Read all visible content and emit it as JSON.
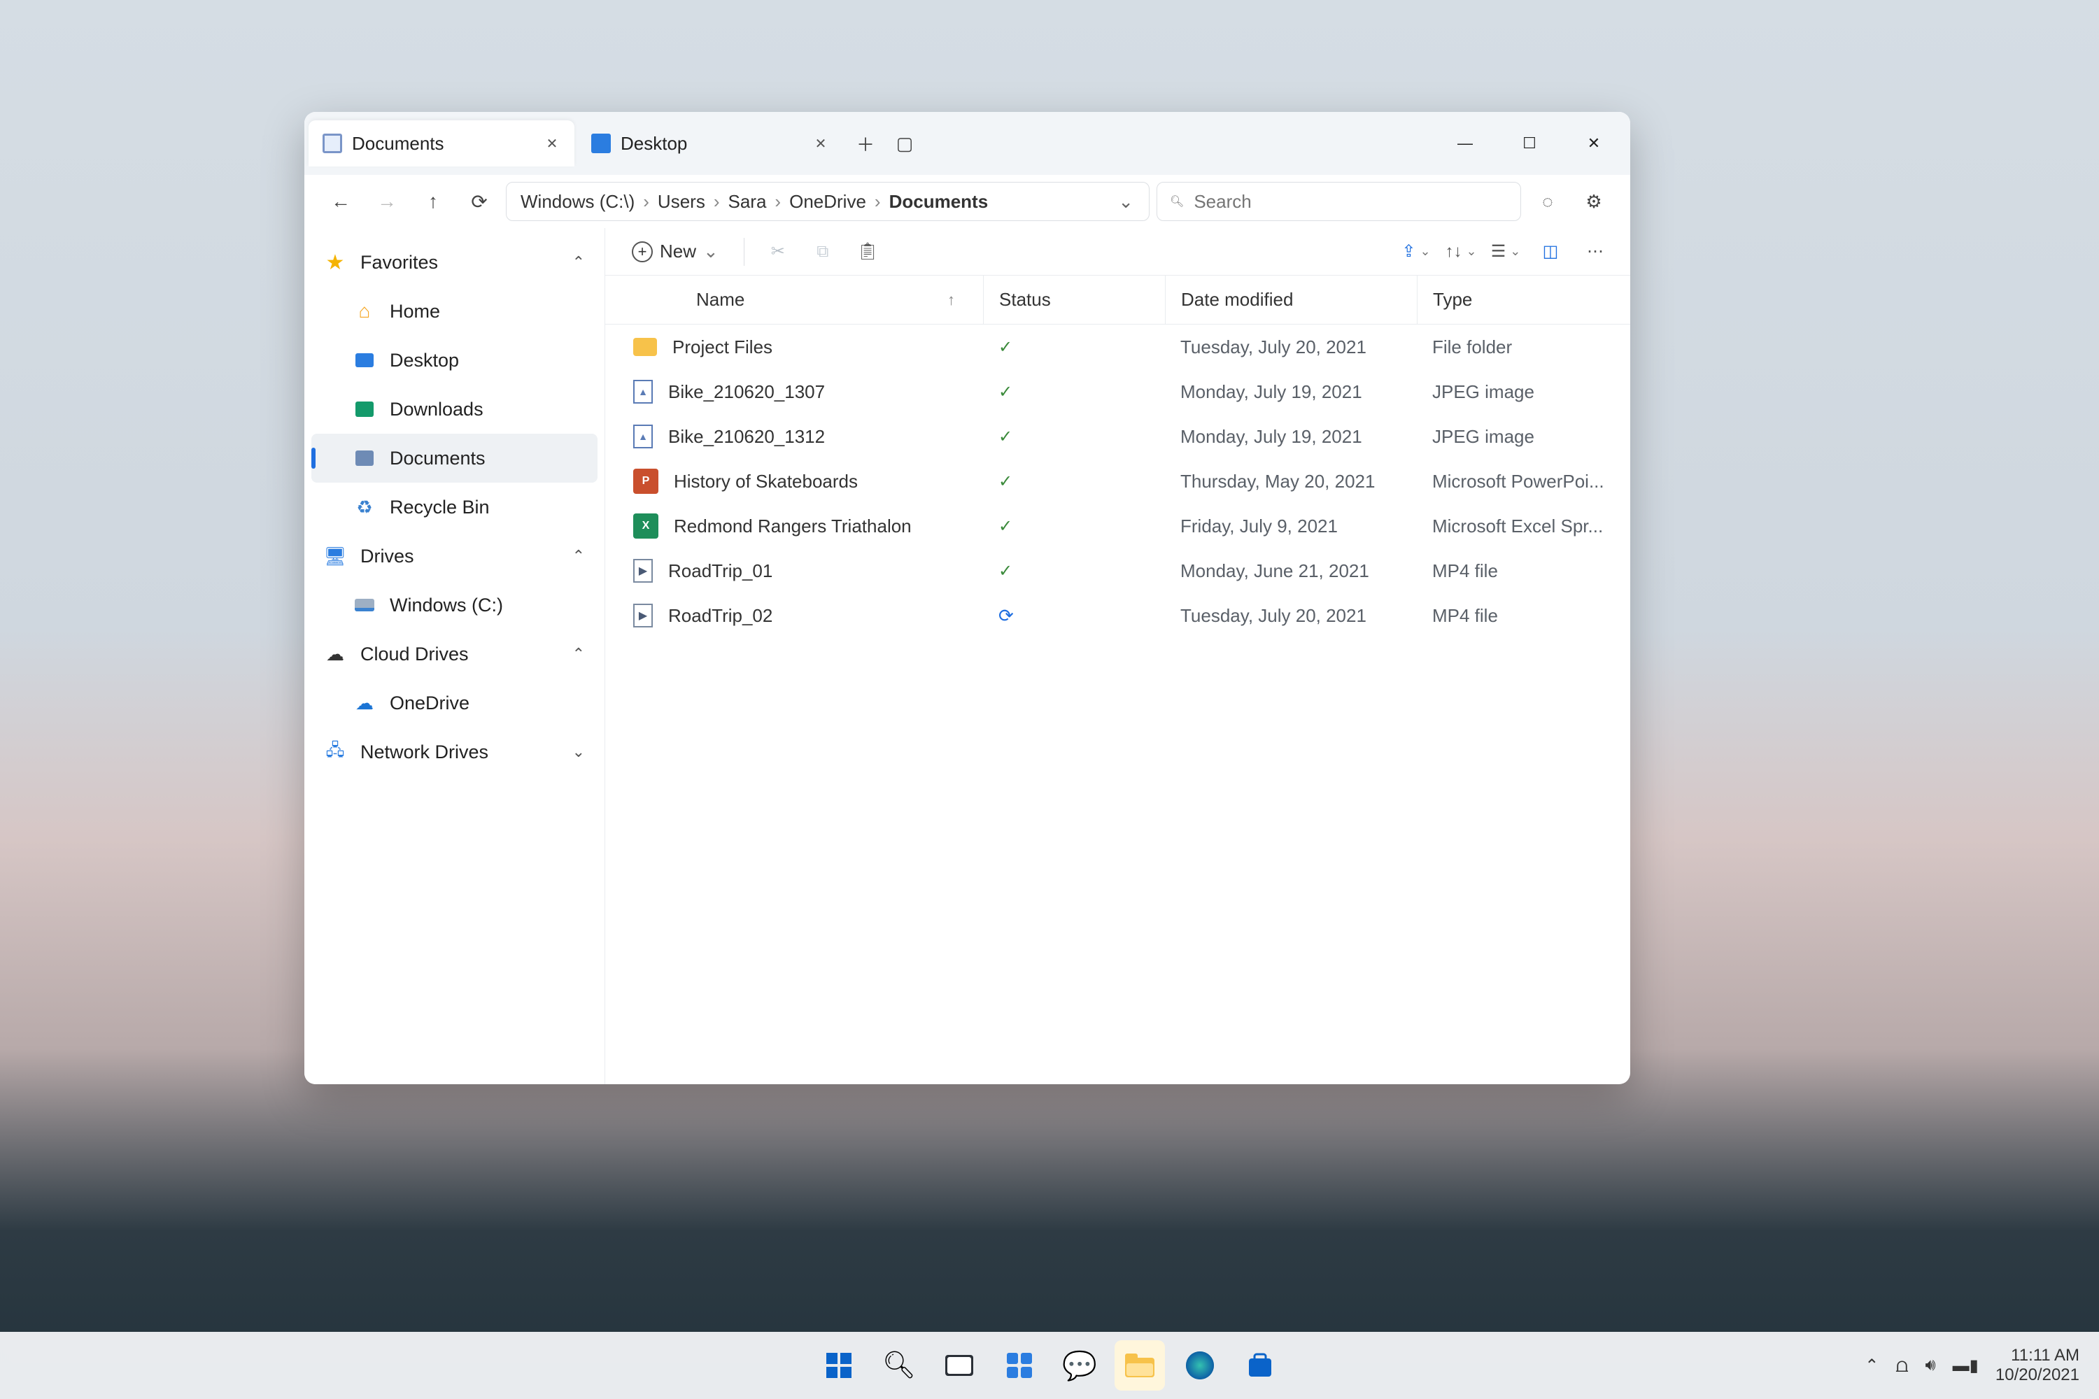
{
  "tabs": [
    {
      "label": "Documents",
      "active": true
    },
    {
      "label": "Desktop",
      "active": false
    }
  ],
  "breadcrumb": [
    "Windows (C:\\)",
    "Users",
    "Sara",
    "OneDrive",
    "Documents"
  ],
  "search": {
    "placeholder": "Search"
  },
  "command": {
    "new_label": "New"
  },
  "sidebar": {
    "sections": [
      {
        "label": "Favorites",
        "icon": "star",
        "items": [
          {
            "label": "Home",
            "icon": "home"
          },
          {
            "label": "Desktop",
            "icon": "desktop"
          },
          {
            "label": "Downloads",
            "icon": "downloads"
          },
          {
            "label": "Documents",
            "icon": "documents",
            "selected": true
          },
          {
            "label": "Recycle Bin",
            "icon": "recycle"
          }
        ]
      },
      {
        "label": "Drives",
        "icon": "monitor",
        "items": [
          {
            "label": "Windows (C:)",
            "icon": "disk"
          }
        ]
      },
      {
        "label": "Cloud Drives",
        "icon": "cloud",
        "items": [
          {
            "label": "OneDrive",
            "icon": "onedrive"
          }
        ]
      },
      {
        "label": "Network Drives",
        "icon": "network",
        "collapsed": true,
        "items": []
      }
    ]
  },
  "columns": {
    "name": "Name",
    "status": "Status",
    "date": "Date modified",
    "type": "Type"
  },
  "files": [
    {
      "name": "Project Files",
      "icon": "folder",
      "status": "check",
      "date": "Tuesday, July 20, 2021",
      "type": "File folder"
    },
    {
      "name": "Bike_210620_1307",
      "icon": "jpeg",
      "status": "check",
      "date": "Monday, July 19, 2021",
      "type": "JPEG image"
    },
    {
      "name": "Bike_210620_1312",
      "icon": "jpeg",
      "status": "check",
      "date": "Monday, July 19, 2021",
      "type": "JPEG image"
    },
    {
      "name": "History of Skateboards",
      "icon": "ppt",
      "status": "check",
      "date": "Thursday, May 20, 2021",
      "type": "Microsoft PowerPoi..."
    },
    {
      "name": "Redmond Rangers Triathalon",
      "icon": "xls",
      "status": "check",
      "date": "Friday, July 9, 2021",
      "type": "Microsoft Excel Spr..."
    },
    {
      "name": "RoadTrip_01",
      "icon": "mp4",
      "status": "check",
      "date": "Monday, June 21, 2021",
      "type": "MP4 file"
    },
    {
      "name": "RoadTrip_02",
      "icon": "mp4",
      "status": "sync",
      "date": "Tuesday, July 20, 2021",
      "type": "MP4 file"
    }
  ],
  "taskbar": {
    "time": "11:11 AM",
    "date": "10/20/2021"
  }
}
